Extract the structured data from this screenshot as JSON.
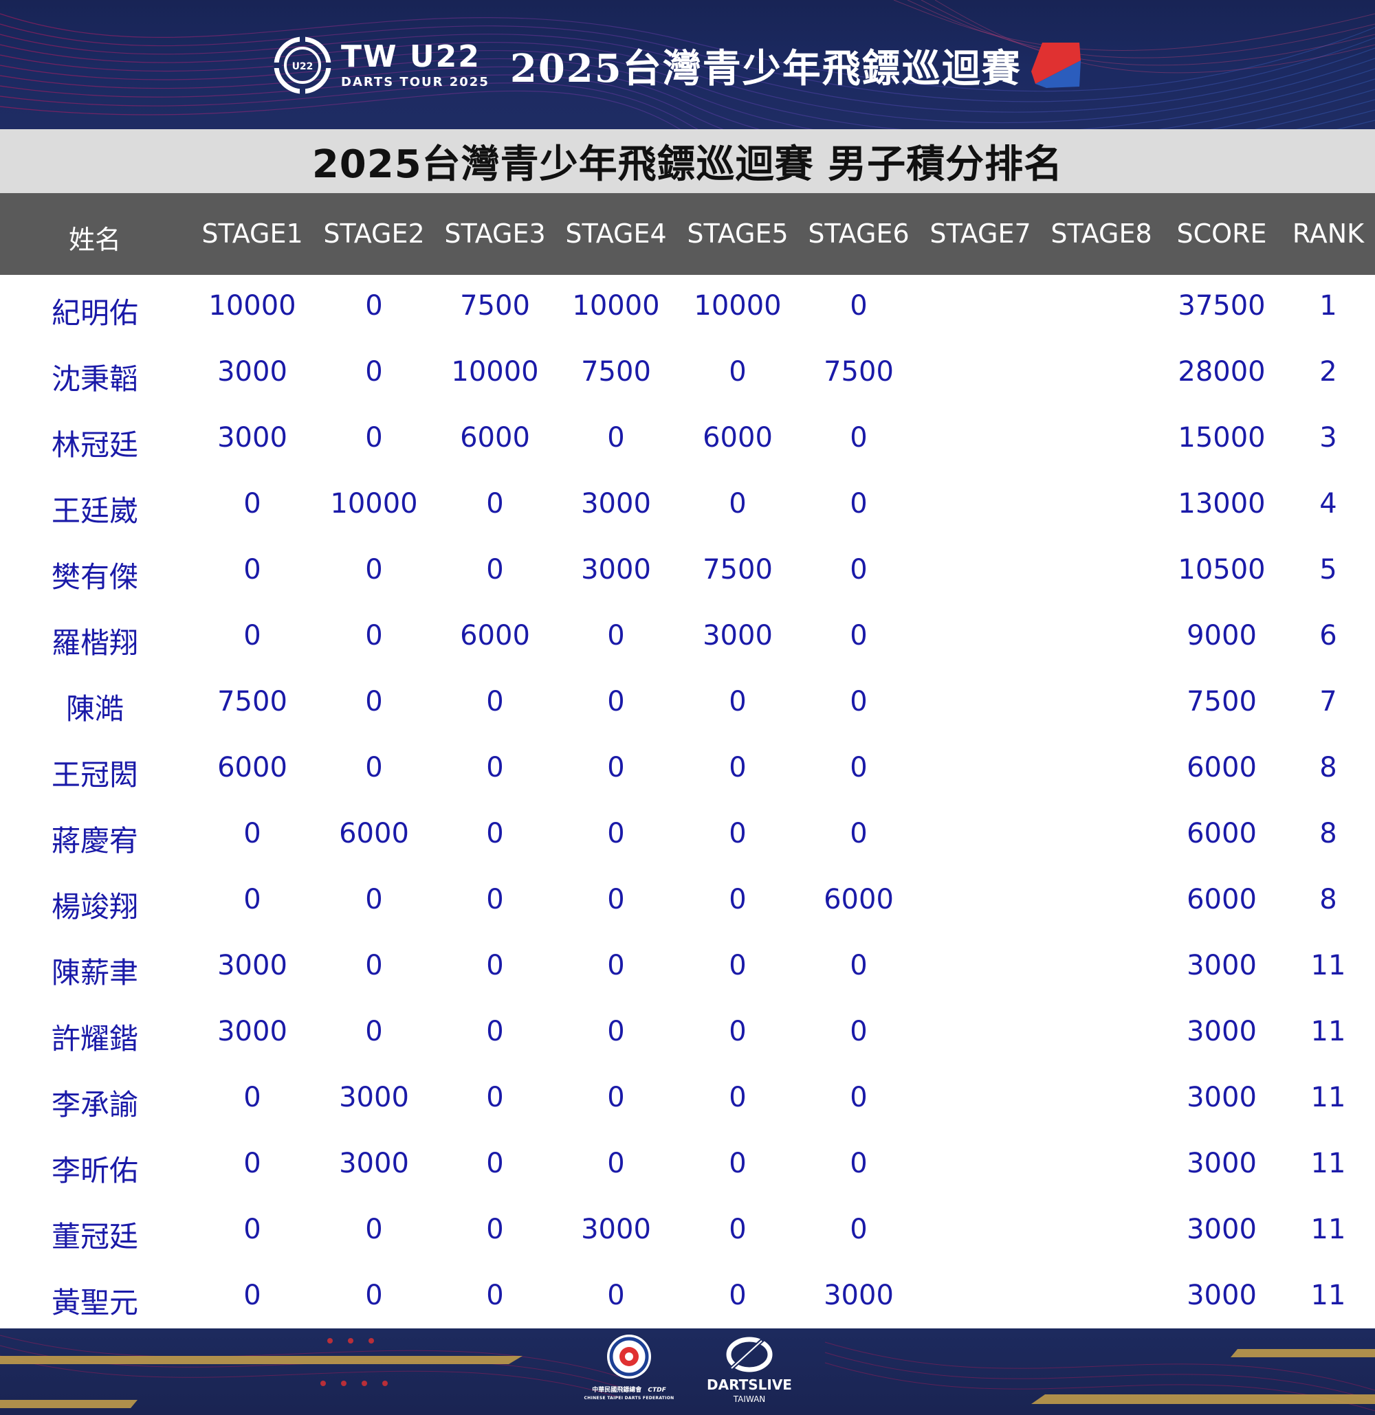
{
  "banner": {
    "brand_main": "TW U22",
    "brand_sub": "DARTS TOUR 2025",
    "brand_badge": "U22",
    "brand_cn": "2025台灣青少年飛鏢巡迴賽",
    "colors": {
      "navy": "#1c2a62",
      "red": "#e03131",
      "blue": "#2b5dbd"
    }
  },
  "page_title": "2025台灣青少年飛鏢巡迴賽 男子積分排名",
  "table": {
    "headers": [
      "姓名",
      "STAGE1",
      "STAGE2",
      "STAGE3",
      "STAGE4",
      "STAGE5",
      "STAGE6",
      "STAGE7",
      "STAGE8",
      "SCORE",
      "RANK"
    ],
    "rows": [
      {
        "name": "紀明佑",
        "stages": [
          "10000",
          "0",
          "7500",
          "10000",
          "10000",
          "0",
          "",
          ""
        ],
        "score": "37500",
        "rank": "1"
      },
      {
        "name": "沈秉韜",
        "stages": [
          "3000",
          "0",
          "10000",
          "7500",
          "0",
          "7500",
          "",
          ""
        ],
        "score": "28000",
        "rank": "2"
      },
      {
        "name": "林冠廷",
        "stages": [
          "3000",
          "0",
          "6000",
          "0",
          "6000",
          "0",
          "",
          ""
        ],
        "score": "15000",
        "rank": "3"
      },
      {
        "name": "王廷崴",
        "stages": [
          "0",
          "10000",
          "0",
          "3000",
          "0",
          "0",
          "",
          ""
        ],
        "score": "13000",
        "rank": "4"
      },
      {
        "name": "樊有傑",
        "stages": [
          "0",
          "0",
          "0",
          "3000",
          "7500",
          "0",
          "",
          ""
        ],
        "score": "10500",
        "rank": "5"
      },
      {
        "name": "羅楷翔",
        "stages": [
          "0",
          "0",
          "6000",
          "0",
          "3000",
          "0",
          "",
          ""
        ],
        "score": "9000",
        "rank": "6"
      },
      {
        "name": "陳澔",
        "stages": [
          "7500",
          "0",
          "0",
          "0",
          "0",
          "0",
          "",
          ""
        ],
        "score": "7500",
        "rank": "7"
      },
      {
        "name": "王冠閎",
        "stages": [
          "6000",
          "0",
          "0",
          "0",
          "0",
          "0",
          "",
          ""
        ],
        "score": "6000",
        "rank": "8"
      },
      {
        "name": "蔣慶宥",
        "stages": [
          "0",
          "6000",
          "0",
          "0",
          "0",
          "0",
          "",
          ""
        ],
        "score": "6000",
        "rank": "8"
      },
      {
        "name": "楊竣翔",
        "stages": [
          "0",
          "0",
          "0",
          "0",
          "0",
          "6000",
          "",
          ""
        ],
        "score": "6000",
        "rank": "8"
      },
      {
        "name": "陳薪聿",
        "stages": [
          "3000",
          "0",
          "0",
          "0",
          "0",
          "0",
          "",
          ""
        ],
        "score": "3000",
        "rank": "11"
      },
      {
        "name": "許耀鍇",
        "stages": [
          "3000",
          "0",
          "0",
          "0",
          "0",
          "0",
          "",
          ""
        ],
        "score": "3000",
        "rank": "11"
      },
      {
        "name": "李承諭",
        "stages": [
          "0",
          "3000",
          "0",
          "0",
          "0",
          "0",
          "",
          ""
        ],
        "score": "3000",
        "rank": "11"
      },
      {
        "name": "李昕佑",
        "stages": [
          "0",
          "3000",
          "0",
          "0",
          "0",
          "0",
          "",
          ""
        ],
        "score": "3000",
        "rank": "11"
      },
      {
        "name": "董冠廷",
        "stages": [
          "0",
          "0",
          "0",
          "3000",
          "0",
          "0",
          "",
          ""
        ],
        "score": "3000",
        "rank": "11"
      },
      {
        "name": "黃聖元",
        "stages": [
          "0",
          "0",
          "0",
          "0",
          "0",
          "3000",
          "",
          ""
        ],
        "score": "3000",
        "rank": "11"
      }
    ]
  },
  "footer": {
    "ctdf_cn": "中華民國飛鏢總會",
    "ctdf_abbr": "CTDF",
    "ctdf_en": "CHINESE TAIPEI DARTS FEDERATION",
    "dartslive": "DARTSLIVE",
    "dartslive_sub": "TAIWAN"
  }
}
